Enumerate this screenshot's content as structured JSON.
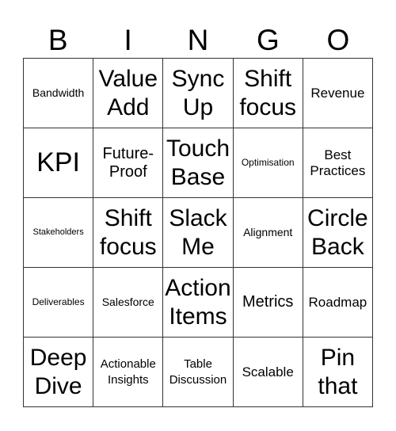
{
  "header": {
    "letters": [
      "B",
      "I",
      "N",
      "G",
      "O"
    ]
  },
  "grid": {
    "rows": [
      [
        "Bandwidth",
        "Value Add",
        "Sync Up",
        "Shift focus",
        "Revenue"
      ],
      [
        "KPI",
        "Future-Proof",
        "Touch Base",
        "Optimisation",
        "Best Practices"
      ],
      [
        "Stakeholders",
        "Shift focus",
        "Slack Me",
        "Alignment",
        "Circle Back"
      ],
      [
        "Deliverables",
        "Salesforce",
        "Action Items",
        "Metrics",
        "Roadmap"
      ],
      [
        "Deep Dive",
        "Actionable Insights",
        "Table Discussion",
        "Scalable",
        "Pin that"
      ]
    ]
  }
}
